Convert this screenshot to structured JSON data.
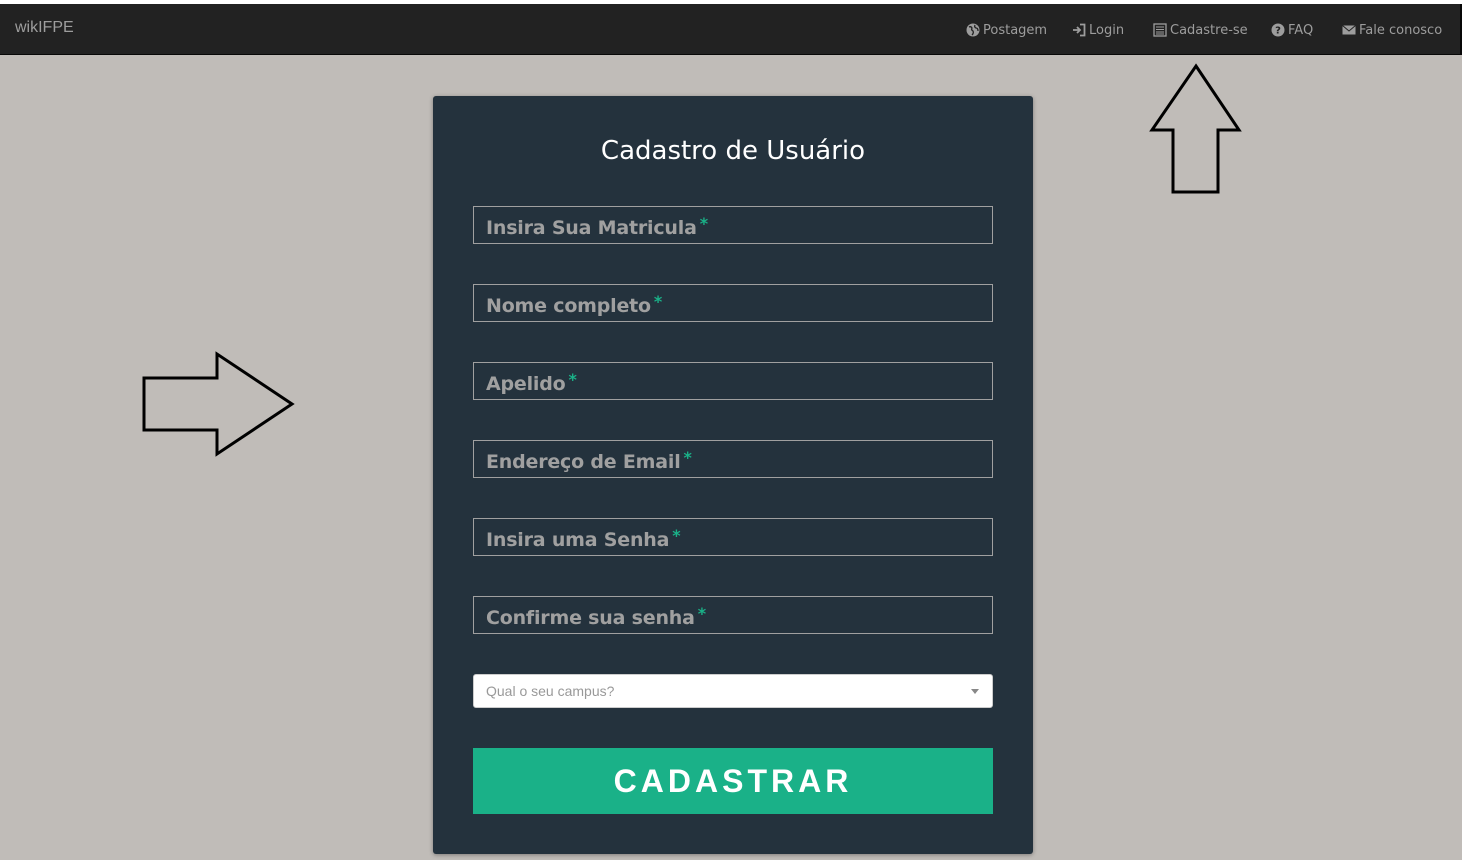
{
  "navbar": {
    "brand": "wikIFPE",
    "items": [
      {
        "label": "Postagem",
        "icon": "globe-icon"
      },
      {
        "label": "Login",
        "icon": "login-icon"
      },
      {
        "label": "Cadastre-se",
        "icon": "list-alt-icon"
      },
      {
        "label": "FAQ",
        "icon": "question-circle-icon"
      },
      {
        "label": "Fale conosco",
        "icon": "envelope-icon"
      }
    ]
  },
  "form": {
    "title": "Cadastro de Usuário",
    "required_marker": "*",
    "fields": [
      {
        "label": "Insira Sua Matricula"
      },
      {
        "label": "Nome completo"
      },
      {
        "label": "Apelido"
      },
      {
        "label": "Endereço de Email"
      },
      {
        "label": "Insira uma Senha"
      },
      {
        "label": "Confirme sua senha"
      }
    ],
    "campus_select": {
      "placeholder": "Qual o seu campus?"
    },
    "submit_label": "CADASTRAR"
  },
  "colors": {
    "navbar_bg": "#222222",
    "card_bg": "#24323d",
    "accent": "#1ab188",
    "page_bg": "#c0bcb8"
  }
}
